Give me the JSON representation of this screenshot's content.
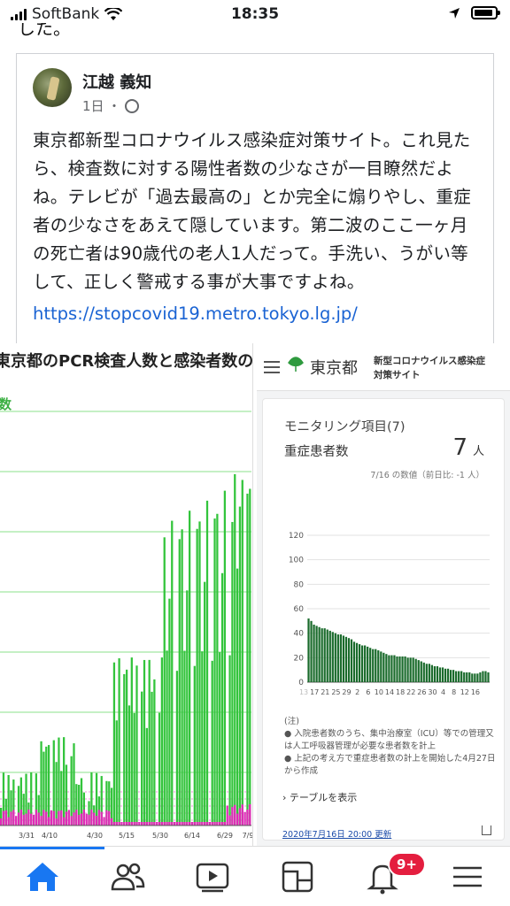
{
  "status": {
    "carrier": "SoftBank",
    "time": "18:35"
  },
  "prev_text_fragment": "した。",
  "post": {
    "author": "江越 義知",
    "age": "1日",
    "dot": "・",
    "text": "東京都新型コロナウイルス感染症対策サイト。これ見たら、検査数に対する陽性者数の少なさが一目瞭然だよね。テレビが「過去最高の」とか完全に煽りやし、重症者の少なさをあえて隠しています。第二波のここ一ヶ月の死亡者は90歳代の老人1人だって。手洗い、うがい等して、正しく警戒する事が大事ですよね。",
    "link": "https://stopcovid19.metro.tokyo.lg.jp/"
  },
  "left_image": {
    "title": "東京都のPCR検査人数と感染者数の推移",
    "legend_fragment": "数",
    "x_ticks": [
      "3/31",
      "4/10",
      "4/30",
      "5/15",
      "5/30",
      "6/14",
      "6/29",
      "7/9"
    ],
    "colors": {
      "tests": "#33c43c",
      "positives": "#e02bb8"
    }
  },
  "right_image": {
    "org": "東京都",
    "site_line1": "新型コロナウイルス感染症",
    "site_line2": "対策サイト",
    "panel_title": "モニタリング項目(7)",
    "metric_label": "重症患者数",
    "metric_value": "7",
    "metric_unit": "人",
    "as_of": "7/16 の数値（前日比: -1 人）",
    "notes": [
      "(注)",
      "● 入院患者数のうち、集中治療室（ICU）等での管理又は人工呼吸器管理が必要な患者数を計上",
      "● 上記の考え方で重症患者数の計上を開始した4月27日から作成"
    ],
    "table_link": "テーブルを表示",
    "updated": "2020年7月16日 20:00 更新"
  },
  "chart_data": {
    "type": "bar",
    "title": "",
    "y_ticks": [
      "0",
      "20",
      "40",
      "60",
      "80",
      "100",
      "120"
    ],
    "ylim": [
      0,
      120
    ],
    "x_ticks": [
      "13",
      "17",
      "21",
      "25",
      "29",
      "2",
      "6",
      "10",
      "14",
      "18",
      "22",
      "26",
      "30",
      "4",
      "8",
      "12",
      "16"
    ],
    "month_labels": [
      "6月",
      "7月"
    ],
    "values": [
      52,
      50,
      47,
      46,
      45,
      44,
      44,
      43,
      42,
      41,
      40,
      39,
      39,
      38,
      37,
      36,
      35,
      33,
      32,
      31,
      30,
      30,
      29,
      28,
      27,
      27,
      26,
      25,
      24,
      23,
      22,
      22,
      22,
      21,
      21,
      21,
      21,
      20,
      20,
      20,
      19,
      18,
      17,
      16,
      15,
      15,
      14,
      13,
      13,
      12,
      12,
      11,
      11,
      10,
      10,
      9,
      9,
      9,
      8,
      8,
      8,
      7,
      7,
      7,
      8,
      9,
      9,
      8
    ],
    "color": "#1a6b2c"
  },
  "tabbar": {
    "badge": "9+"
  }
}
